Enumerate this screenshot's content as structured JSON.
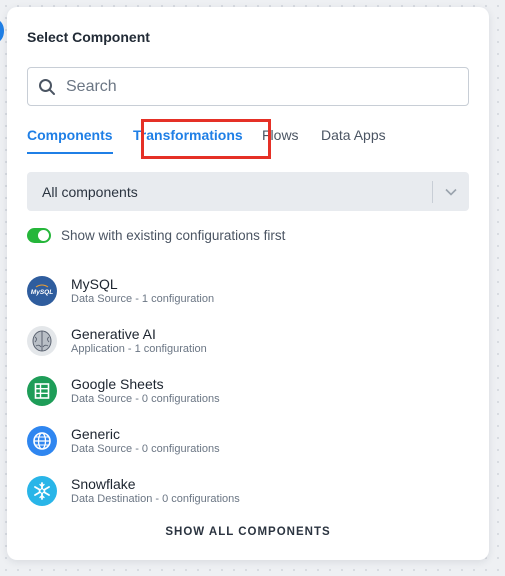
{
  "panel": {
    "title": "Select Component"
  },
  "search": {
    "placeholder": "Search",
    "value": ""
  },
  "tabs": [
    {
      "label": "Components",
      "state": "active"
    },
    {
      "label": "Transformations",
      "state": "highlighted"
    },
    {
      "label": "Flows",
      "state": "normal"
    },
    {
      "label": "Data Apps",
      "state": "normal"
    }
  ],
  "filter": {
    "selected": "All components"
  },
  "toggle": {
    "label": "Show with existing configurations first",
    "on": true
  },
  "components": [
    {
      "name": "MySQL",
      "meta": "Data Source - 1 configuration",
      "icon": "mysql-logo-icon",
      "color": "#2f5d9e"
    },
    {
      "name": "Generative AI",
      "meta": "Application - 1 configuration",
      "icon": "brain-icon",
      "color": "#e4e7ea"
    },
    {
      "name": "Google Sheets",
      "meta": "Data Source - 0 configurations",
      "icon": "google-sheets-icon",
      "color": "#1e9d58"
    },
    {
      "name": "Generic",
      "meta": "Data Source - 0 configurations",
      "icon": "globe-icon",
      "color": "#2f86f0"
    },
    {
      "name": "Snowflake",
      "meta": "Data Destination - 0 configurations",
      "icon": "snowflake-icon",
      "color": "#29b5e8"
    }
  ],
  "footer": {
    "show_all_label": "SHOW ALL COMPONENTS"
  },
  "colors": {
    "accent": "#1f7fe6",
    "highlight_box": "#e53026",
    "toggle_on": "#25b63a"
  }
}
